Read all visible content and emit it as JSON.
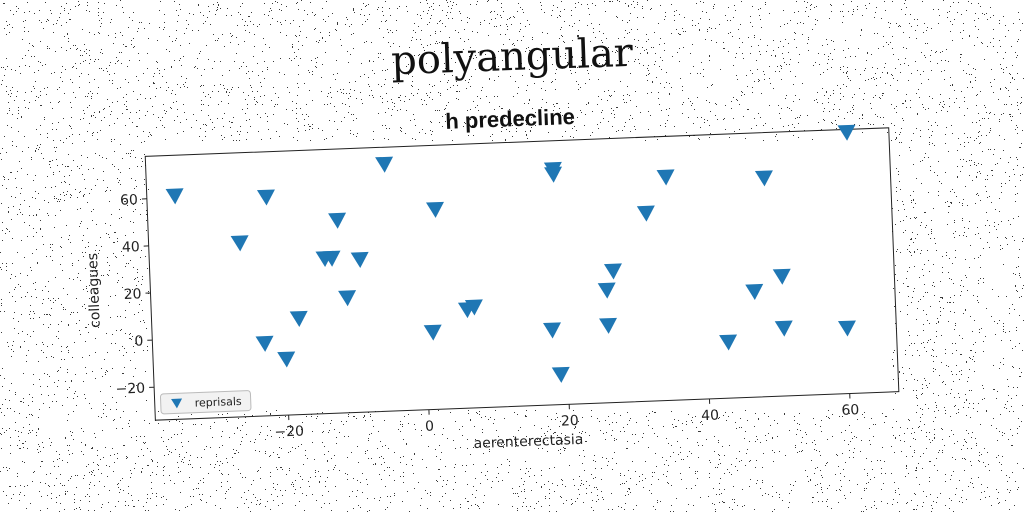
{
  "page": {
    "title": "polyangular"
  },
  "chart_data": {
    "type": "scatter",
    "title": "h predecline",
    "xlabel": "aerenterectasia",
    "ylabel": "colleagues",
    "xlim": [
      -39,
      67
    ],
    "ylim": [
      -34,
      78
    ],
    "xticks": [
      -20,
      0,
      20,
      40,
      60
    ],
    "yticks": [
      -20,
      0,
      20,
      40,
      60
    ],
    "legend": {
      "placement": "lower-left",
      "entries": [
        "reprisals"
      ]
    },
    "marker": "triangle-down",
    "series": [
      {
        "name": "reprisals",
        "color": "#1f77b4",
        "points": [
          [
            -35,
            61
          ],
          [
            -26,
            40
          ],
          [
            -22,
            59
          ],
          [
            -23,
            -3
          ],
          [
            -20,
            -10
          ],
          [
            -18,
            7
          ],
          [
            -14,
            32
          ],
          [
            -13,
            32
          ],
          [
            -12,
            48
          ],
          [
            -11,
            15
          ],
          [
            -9,
            31
          ],
          [
            -5,
            71
          ],
          [
            1,
            -1
          ],
          [
            2,
            51
          ],
          [
            6,
            8
          ],
          [
            7,
            9
          ],
          [
            18,
            -2
          ],
          [
            19,
            66
          ],
          [
            19,
            64
          ],
          [
            19,
            -21
          ],
          [
            26,
            14
          ],
          [
            26,
            -1
          ],
          [
            27,
            22
          ],
          [
            32,
            46
          ],
          [
            35,
            61
          ],
          [
            43,
            -10
          ],
          [
            47,
            11
          ],
          [
            49,
            59
          ],
          [
            51,
            17
          ],
          [
            51,
            -5
          ],
          [
            60,
            -6
          ],
          [
            61,
            77
          ]
        ]
      }
    ],
    "grid": false
  }
}
